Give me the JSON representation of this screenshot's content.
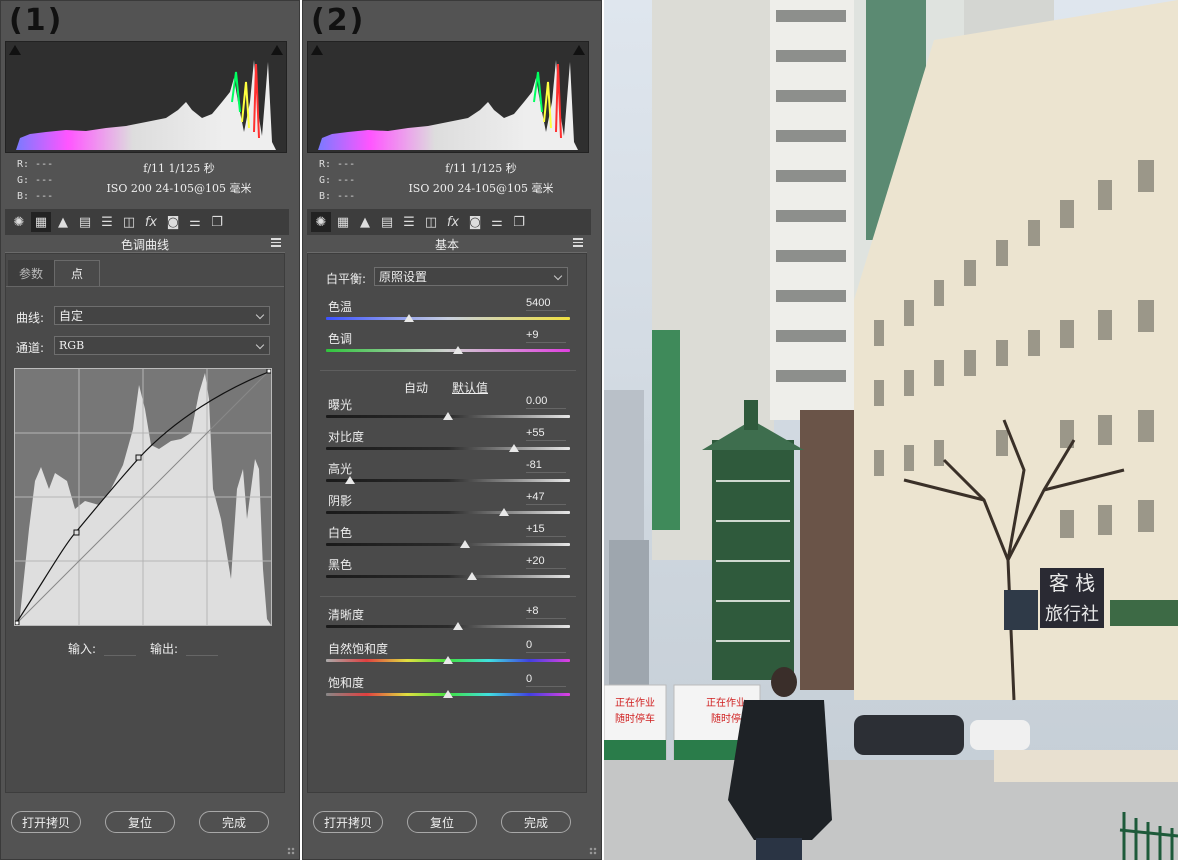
{
  "labels": {
    "panel1": "(1)",
    "panel2": "(2)"
  },
  "info": {
    "r": "R:  ---",
    "g": "G:  ---",
    "b": "B:  ---",
    "exposure": "f/11   1/125 秒",
    "iso_lens": "ISO 200   24-105@105 毫米"
  },
  "tab_icons": [
    "aperture-icon",
    "grid-icon",
    "mountain-icon",
    "split-icon",
    "hsl-icon",
    "lens-icon",
    "fx-icon",
    "camera-icon",
    "sliders-icon",
    "presets-icon"
  ],
  "panel1": {
    "title": "色调曲线",
    "subtab_param": "参数",
    "subtab_point": "点",
    "curve_label": "曲线:",
    "curve_value": "自定",
    "channel_label": "通道:",
    "channel_value": "RGB",
    "input_label": "输入:",
    "output_label": "输出:"
  },
  "panel2": {
    "title": "基本",
    "wb_label": "白平衡:",
    "wb_value": "原照设置",
    "auto": "自动",
    "default": "默认值",
    "sliders": [
      {
        "label": "色温",
        "value": "5400",
        "pos": 0.34
      },
      {
        "label": "色调",
        "value": "+9",
        "pos": 0.54
      },
      {
        "label": "曝光",
        "value": "0.00",
        "pos": 0.5
      },
      {
        "label": "对比度",
        "value": "+55",
        "pos": 0.77
      },
      {
        "label": "高光",
        "value": "-81",
        "pos": 0.1
      },
      {
        "label": "阴影",
        "value": "+47",
        "pos": 0.73
      },
      {
        "label": "白色",
        "value": "+15",
        "pos": 0.57
      },
      {
        "label": "黑色",
        "value": "+20",
        "pos": 0.6
      },
      {
        "label": "清晰度",
        "value": "+8",
        "pos": 0.54
      },
      {
        "label": "自然饱和度",
        "value": "0",
        "pos": 0.5
      },
      {
        "label": "饱和度",
        "value": "0",
        "pos": 0.5
      }
    ]
  },
  "buttons": {
    "open_copy": "打开拷贝",
    "reset": "复位",
    "done": "完成"
  },
  "photo": {
    "sign_top": "客 栈",
    "sign_bottom": "旅行社",
    "truck_text_1": "正在作业",
    "truck_text_2": "随时停车",
    "truck2_text_1": "正在作业",
    "truck2_text_2": "随时停"
  }
}
